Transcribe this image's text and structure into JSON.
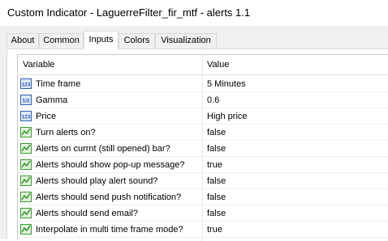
{
  "window": {
    "title": "Custom Indicator - LaguerreFilter_fir_mtf - alerts 1.1"
  },
  "tabs": [
    {
      "label": "About",
      "active": false
    },
    {
      "label": "Common",
      "active": false
    },
    {
      "label": "Inputs",
      "active": true
    },
    {
      "label": "Colors",
      "active": false
    },
    {
      "label": "Visualization",
      "active": false
    }
  ],
  "table": {
    "headers": {
      "variable": "Variable",
      "value": "Value"
    },
    "rows": [
      {
        "icon": "enum-icon",
        "variable": "Time frame",
        "value": "5 Minutes"
      },
      {
        "icon": "double-icon",
        "variable": "Gamma",
        "value": "0.6"
      },
      {
        "icon": "enum-icon",
        "variable": "Price",
        "value": "High price"
      },
      {
        "icon": "bool-icon",
        "variable": "Turn alerts on?",
        "value": "false"
      },
      {
        "icon": "bool-icon",
        "variable": "Alerts on currnt (still opened) bar?",
        "value": "false"
      },
      {
        "icon": "bool-icon",
        "variable": "Alerts should show pop-up message?",
        "value": "true"
      },
      {
        "icon": "bool-icon",
        "variable": "Alerts should play alert sound?",
        "value": "false"
      },
      {
        "icon": "bool-icon",
        "variable": "Alerts should send push notification?",
        "value": "false"
      },
      {
        "icon": "bool-icon",
        "variable": "Alerts should send email?",
        "value": "false"
      },
      {
        "icon": "bool-icon",
        "variable": "Interpolate in multi time frame mode?",
        "value": "true"
      }
    ]
  },
  "icon_glyphs": {
    "enum": "123",
    "double": "1/2"
  },
  "colors": {
    "enum_icon": "#2f5fb3",
    "double_icon": "#2f5fb3",
    "bool_icon": "#3a9b2f"
  }
}
